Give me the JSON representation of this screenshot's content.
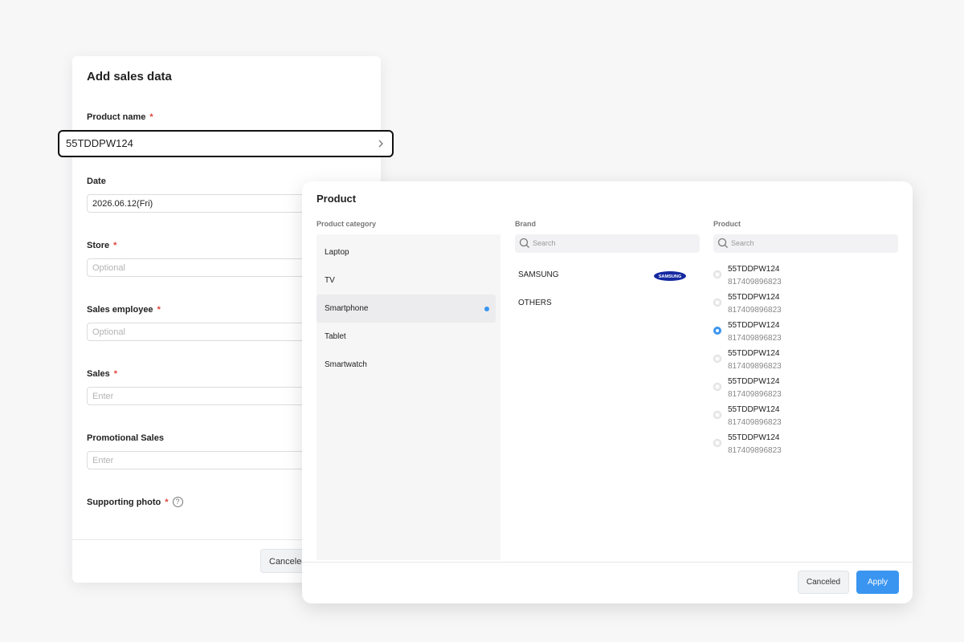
{
  "sales_form": {
    "title": "Add sales data",
    "product_name": {
      "label": "Product name",
      "required": "*",
      "value": "55TDDPW124"
    },
    "date": {
      "label": "Date",
      "value": "2026.06.12(Fri)"
    },
    "store": {
      "label": "Store",
      "required": "*",
      "placeholder": "Optional"
    },
    "sales_employee": {
      "label": "Sales employee",
      "required": "*",
      "placeholder": "Optional"
    },
    "sales": {
      "label": "Sales",
      "required": "*",
      "placeholder": "Enter"
    },
    "promotional_sales": {
      "label": "Promotional Sales",
      "placeholder": "Enter"
    },
    "supporting_photo": {
      "label": "Supporting photo",
      "required": "*",
      "help": "?"
    },
    "cancel_label": "Canceled"
  },
  "product_modal": {
    "title": "Product",
    "category_header": "Product category",
    "brand_header": "Brand",
    "product_header": "Product",
    "categories": [
      {
        "label": "Laptop"
      },
      {
        "label": "TV"
      },
      {
        "label": "Smartphone",
        "selected": true
      },
      {
        "label": "Tablet"
      },
      {
        "label": "Smartwatch"
      }
    ],
    "brand_search_placeholder": "Search",
    "product_search_placeholder": "Search",
    "brands": [
      {
        "label": "SAMSUNG",
        "logo": "SAMSUNG"
      },
      {
        "label": "OTHERS"
      }
    ],
    "products": [
      {
        "name": "55TDDPW124",
        "code": "817409896823",
        "selected": false
      },
      {
        "name": "55TDDPW124",
        "code": "817409896823",
        "selected": false
      },
      {
        "name": "55TDDPW124",
        "code": "817409896823",
        "selected": true
      },
      {
        "name": "55TDDPW124",
        "code": "817409896823",
        "selected": false
      },
      {
        "name": "55TDDPW124",
        "code": "817409896823",
        "selected": false
      },
      {
        "name": "55TDDPW124",
        "code": "817409896823",
        "selected": false
      },
      {
        "name": "55TDDPW124",
        "code": "817409896823",
        "selected": false
      }
    ],
    "cancel_label": "Canceled",
    "apply_label": "Apply"
  },
  "colors": {
    "accent": "#3a95f0",
    "required": "#e0453c",
    "samsung_blue": "#1428a0"
  }
}
